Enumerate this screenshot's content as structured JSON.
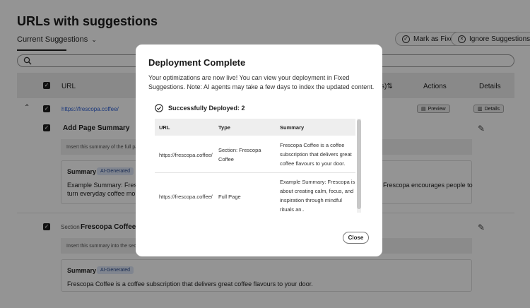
{
  "page": {
    "title": "URLs with suggestions"
  },
  "tabs": {
    "current": "Current Suggestions"
  },
  "actions": {
    "mark_fixed": "Mark as Fixed",
    "ignore": "Ignore Suggestions"
  },
  "table": {
    "headers": {
      "url": "URL",
      "sort_tail": "s)⇅",
      "actions": "Actions",
      "details": "Details"
    },
    "row": {
      "url": "https://frescopa.coffee/",
      "preview": "Preview",
      "details": "Details"
    },
    "suggestions": [
      {
        "prefix": "",
        "title": "Add Page Summary",
        "note": "Insert this summary of the full page c",
        "summary_label": "Summary",
        "badge": "AI-Generated",
        "text_line1": "Example Summary: Frescop",
        "text_line1_right": "Frescopa encourages people to",
        "text_line2": "turn everyday coffee mome"
      },
      {
        "prefix": "Section",
        "title": "Frescopa Coffee",
        "note": "Insert this summary into the section w",
        "summary_label": "Summary",
        "badge": "AI-Generated",
        "text_line1": "Frescopa Coffee is a coffee subscription that delivers great coffee flavours to your door."
      }
    ]
  },
  "modal": {
    "title": "Deployment Complete",
    "description": "Your optimizations are now live! You can view your deployment in Fixed Suggestions. Note: AI agents may take a few days to index the updated content.",
    "deployed_label": "Successfully Deployed: 2",
    "columns": [
      "URL",
      "Type",
      "Summary"
    ],
    "rows": [
      {
        "url": "https://frescopa.coffee/",
        "type_lines": [
          "Section: Frescopa",
          "Coffee"
        ],
        "summary_lines": [
          "Frescopa Coffee is a coffee",
          "subscription that delivers great",
          "coffee flavours to your door."
        ]
      },
      {
        "url": "https://frescopa.coffee/",
        "type_lines": [
          "Full Page"
        ],
        "summary_lines": [
          "Example Summary: Frescopa is",
          "about creating calm, focus, and",
          "inspiration through mindful",
          "rituals an.."
        ]
      }
    ],
    "close": "Close"
  }
}
